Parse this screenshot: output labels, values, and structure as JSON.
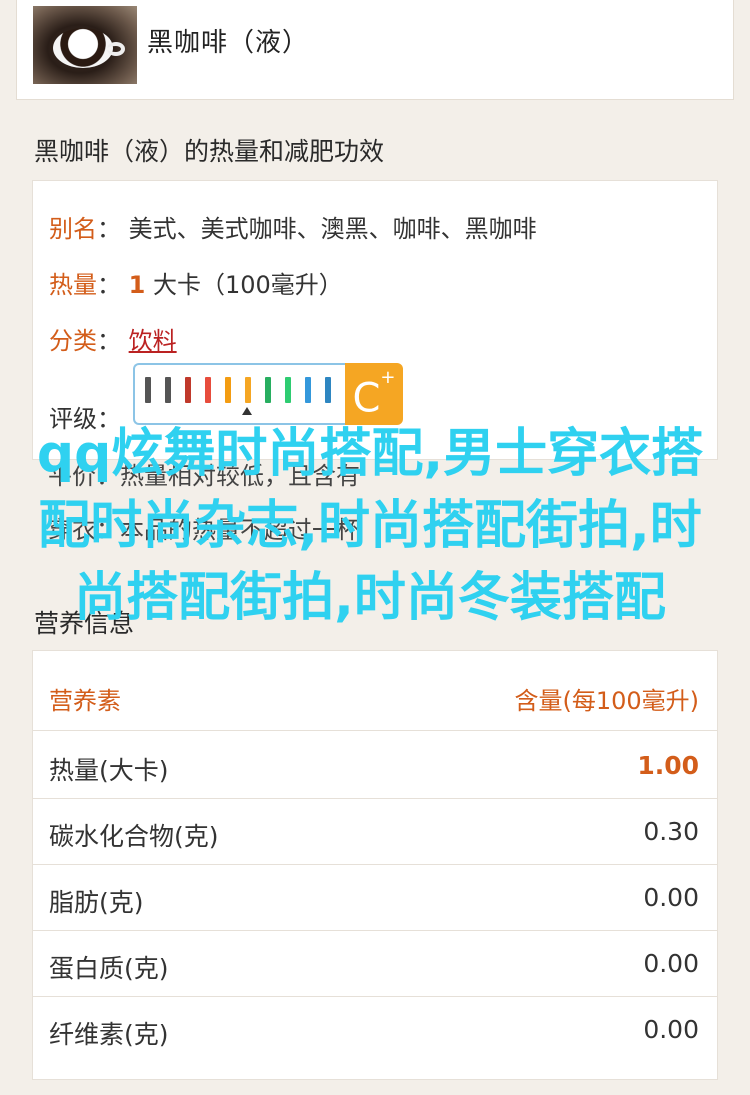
{
  "header": {
    "title": "黑咖啡（液）"
  },
  "section1": {
    "title": "黑咖啡（液）的热量和减肥功效"
  },
  "info": {
    "alias_label": "别名",
    "alias_value": "美式、美式咖啡、澳黑、咖啡、黑咖啡",
    "calorie_label": "热量",
    "calorie_number": "1",
    "calorie_unit": "大卡（100毫升）",
    "category_label": "分类",
    "category_value": "饮料",
    "rating_label": "评级",
    "rating_grade": "C",
    "rating_plus": "+"
  },
  "overlay": {
    "text": "qq炫舞时尚搭配,男士穿衣搭配时尚杂志,时尚搭配街拍,时尚搭配街拍,时尚冬装搭配"
  },
  "hidden_text": {
    "line1": "平价：热量相对较低，且含有",
    "line2": "穿衣：本品的热量不超过一杯"
  },
  "section2": {
    "title": "营养信息"
  },
  "nutrition": {
    "head_left": "营养素",
    "head_right": "含量(每100毫升)",
    "rows": [
      {
        "name": "热量(大卡)",
        "value": "1.00"
      },
      {
        "name": "碳水化合物(克)",
        "value": "0.30"
      },
      {
        "name": "脂肪(克)",
        "value": "0.00"
      },
      {
        "name": "蛋白质(克)",
        "value": "0.00"
      },
      {
        "name": "纤维素(克)",
        "value": "0.00"
      }
    ]
  },
  "colors": {
    "accent": "#d35d1a",
    "overlay": "#2fd1f0",
    "grade": "#f5a623"
  }
}
